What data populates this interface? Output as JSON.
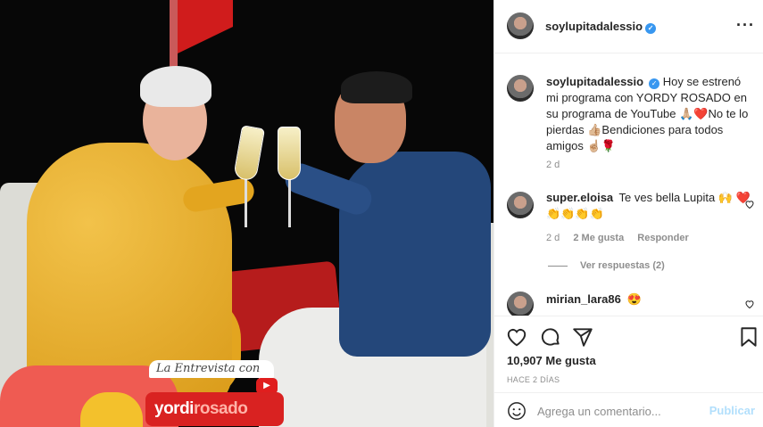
{
  "post": {
    "author": "soylupitadalessio",
    "more_label": "···",
    "caption_text": "Hoy se estrenó mi programa con YORDY ROSADO en su programa de YouTube 🙏🏼❤️No te lo pierdas 👍🏼Bendiciones para todos amigos ☝🏼🌹",
    "caption_time": "2 d",
    "sign_top": "La Entrevista con",
    "sign_main_a": "yordi",
    "sign_main_b": "rosado",
    "sign_yt": "▶"
  },
  "comments": [
    {
      "username": "super.eloisa",
      "text": "Te ves bella Lupita 🙌 ❤️👏👏👏👏",
      "time": "2 d",
      "likes": "2 Me gusta",
      "reply": "Responder",
      "view_replies": "Ver respuestas (2)"
    },
    {
      "username": "mirian_lara86",
      "text": "😍"
    }
  ],
  "actions": {
    "likes": "10,907 Me gusta",
    "ago": "HACE 2 DÍAS"
  },
  "comment_box": {
    "placeholder": "Agrega un comentario...",
    "publish": "Publicar"
  },
  "icons": [
    "like-icon",
    "comment-icon",
    "share-icon",
    "save-icon",
    "emoji-icon",
    "heart-icon",
    "more-icon",
    "verified-icon"
  ],
  "colors": {
    "verified": "#3897f0",
    "publish_disabled": "#b2dffc",
    "meta": "#8e8e8e"
  }
}
